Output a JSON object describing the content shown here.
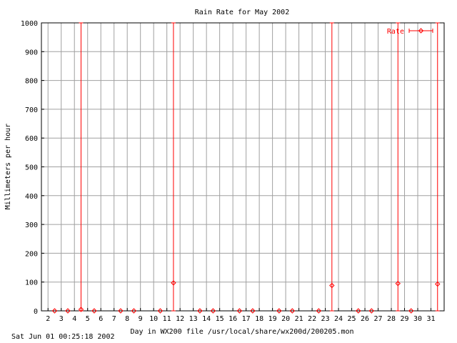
{
  "chart_data": {
    "type": "scatter",
    "title": "Rain Rate for May 2002",
    "xlabel": "Day in WX200 file /usr/local/share/wx200d/200205.mon",
    "ylabel": "Millimeters per hour",
    "xlim": [
      1.5,
      32
    ],
    "ylim": [
      0,
      1000
    ],
    "x_ticks": [
      2,
      3,
      4,
      5,
      6,
      7,
      8,
      9,
      10,
      11,
      12,
      13,
      14,
      15,
      16,
      17,
      18,
      19,
      20,
      21,
      22,
      23,
      24,
      25,
      26,
      27,
      28,
      29,
      30,
      31
    ],
    "y_ticks": [
      0,
      100,
      200,
      300,
      400,
      500,
      600,
      700,
      800,
      900,
      1000
    ],
    "grid": true,
    "legend": "top-right",
    "color": "#ff0000",
    "series": [
      {
        "name": "Rate",
        "style": "points with error bars",
        "points": [
          {
            "x": 2.5,
            "y": 0,
            "low": 0,
            "high": 0
          },
          {
            "x": 3.5,
            "y": 0,
            "low": 0,
            "high": 0
          },
          {
            "x": 4.5,
            "y": 5,
            "low": 0,
            "high": 1000
          },
          {
            "x": 5.5,
            "y": 0,
            "low": 0,
            "high": 0
          },
          {
            "x": 7.5,
            "y": 0,
            "low": 0,
            "high": 0
          },
          {
            "x": 8.5,
            "y": 0,
            "low": 0,
            "high": 0
          },
          {
            "x": 10.5,
            "y": 0,
            "low": 0,
            "high": 0
          },
          {
            "x": 11.5,
            "y": 97,
            "low": 0,
            "high": 1000
          },
          {
            "x": 13.5,
            "y": 0,
            "low": 0,
            "high": 0
          },
          {
            "x": 14.5,
            "y": 0,
            "low": 0,
            "high": 0
          },
          {
            "x": 16.5,
            "y": 0,
            "low": 0,
            "high": 0
          },
          {
            "x": 17.5,
            "y": 0,
            "low": 0,
            "high": 0
          },
          {
            "x": 19.5,
            "y": 0,
            "low": 0,
            "high": 0
          },
          {
            "x": 20.5,
            "y": 0,
            "low": 0,
            "high": 0
          },
          {
            "x": 22.5,
            "y": 0,
            "low": 0,
            "high": 0
          },
          {
            "x": 23.5,
            "y": 88,
            "low": 0,
            "high": 1000
          },
          {
            "x": 25.5,
            "y": 0,
            "low": 0,
            "high": 0
          },
          {
            "x": 26.5,
            "y": 0,
            "low": 0,
            "high": 0
          },
          {
            "x": 28.5,
            "y": 95,
            "low": 0,
            "high": 1000
          },
          {
            "x": 29.5,
            "y": 0,
            "low": 0,
            "high": 0
          },
          {
            "x": 31.5,
            "y": 93,
            "low": 0,
            "high": 1000
          }
        ]
      }
    ]
  },
  "footer": {
    "timestamp": "Sat Jun 01 00:25:18 2002"
  }
}
